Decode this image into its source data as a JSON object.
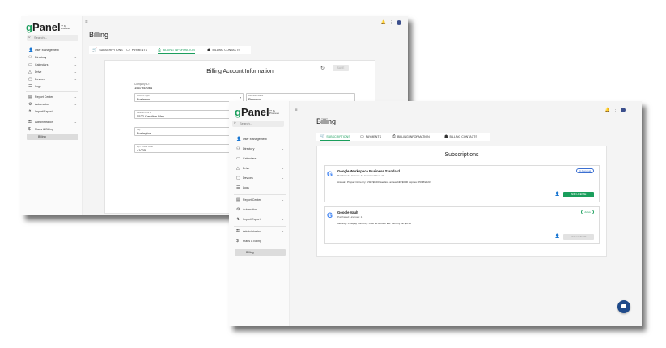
{
  "brand": {
    "logo_g": "g",
    "logo_rest": "Panel",
    "logo_tm": "™ by Promevo",
    "accent": "#1a9e5c"
  },
  "sidebar": {
    "search_placeholder": "Search...",
    "items": [
      {
        "label": "User Management",
        "icon": "user-icon",
        "chevron": ""
      },
      {
        "label": "Directory",
        "icon": "directory-icon",
        "chevron": "⌄"
      },
      {
        "label": "Calendars",
        "icon": "calendar-icon",
        "chevron": "⌄"
      },
      {
        "label": "Drive",
        "icon": "drive-icon",
        "chevron": "⌄"
      },
      {
        "label": "Devices",
        "icon": "devices-icon",
        "chevron": "⌄"
      },
      {
        "label": "Logs",
        "icon": "logs-icon",
        "chevron": ""
      },
      {
        "label": "Report Center",
        "icon": "report-icon",
        "chevron": "⌄"
      },
      {
        "label": "Automation",
        "icon": "automation-icon",
        "chevron": "⌄"
      },
      {
        "label": "Import/Export",
        "icon": "import-export-icon",
        "chevron": "⌄"
      },
      {
        "label": "Administration",
        "icon": "admin-icon",
        "chevron": "⌄"
      },
      {
        "label": "Plans & Billing",
        "icon": "dollar-icon",
        "chevron": "⌃"
      }
    ],
    "sub_item": "Billing"
  },
  "header": {
    "menu_icon": "≡",
    "bell": "🔔",
    "more": "⋮"
  },
  "page_title": "Billing",
  "tabs": [
    {
      "label": "SUBSCRIPTIONS",
      "icon": "cart-icon"
    },
    {
      "label": "PAYMENTS",
      "icon": "card-icon"
    },
    {
      "label": "BILLING INFORMATION",
      "icon": "print-icon"
    },
    {
      "label": "BILLING CONTACTS",
      "icon": "contact-icon"
    }
  ],
  "billing_info": {
    "title": "Billing Account Information",
    "save_label": "SAVE",
    "company_id_label": "Company ID:",
    "company_id": "1567952061",
    "account_type_label": "Account Type *",
    "account_type": "Business",
    "business_name_label": "Business Name *",
    "business_name": "Promevo",
    "address_label": "Address Line 1 *",
    "address": "5522 Carolina Way",
    "city_label": "City *",
    "city": "Burlington",
    "zip_label": "Zip / Postal Code *",
    "zip": "41005"
  },
  "subscriptions": {
    "title": "Subscriptions",
    "items": [
      {
        "name": "Google Workspace Business Standard",
        "meta": "Purchased Licenses: 14    Licenses Used: 14",
        "details": "Annual - Prepay    Currency: USD    $0.00/user    Est. annual bill: $0.00    Expires: 05/08/2023",
        "status": "In Renewal",
        "add_label": "ADD LICENSE",
        "add_enabled": true
      },
      {
        "name": "Google Vault",
        "meta": "Purchased Licenses: 1",
        "details": "Monthly - Postpay    Currency: USD    $0.00/user    Est. monthly bill: $0.00",
        "status": "Active",
        "add_label": "ADD LICENSE",
        "add_enabled": false
      }
    ]
  }
}
